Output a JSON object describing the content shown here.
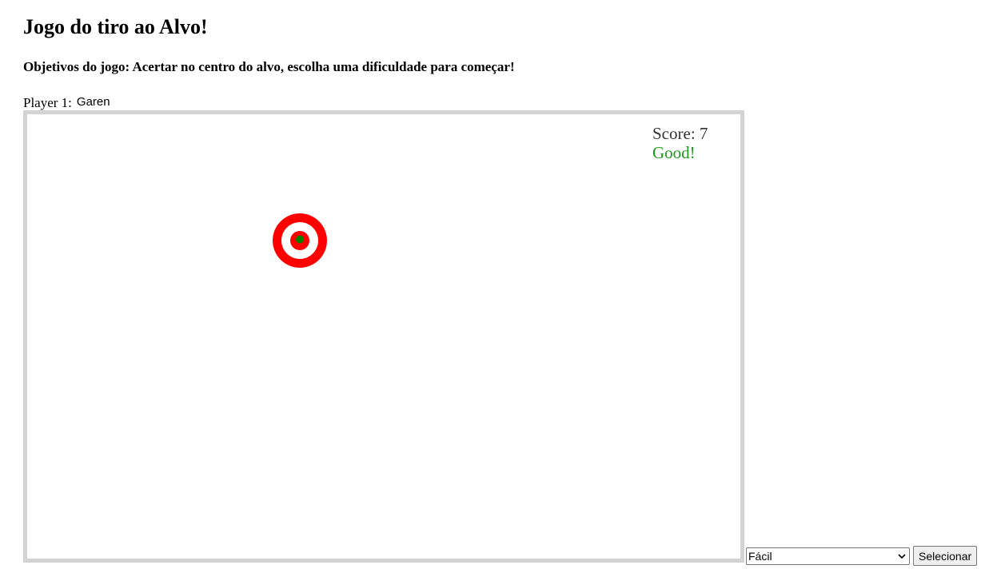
{
  "page": {
    "title": "Jogo do tiro ao Alvo!",
    "objective": "Objetivos do jogo: Acertar no centro do alvo, escolha uma dificuldade para começar!"
  },
  "player": {
    "label": "Player 1:",
    "name": "Garen"
  },
  "game": {
    "score_text": "Score: 7",
    "feedback": "Good!",
    "feedback_color": "#1e9a1e",
    "target_colors": {
      "outer": "#ff0000",
      "ring": "#ffffff",
      "inner": "#ff0000",
      "center": "#008000"
    }
  },
  "controls": {
    "difficulty_selected": "Fácil",
    "select_button_label": "Selecionar"
  }
}
